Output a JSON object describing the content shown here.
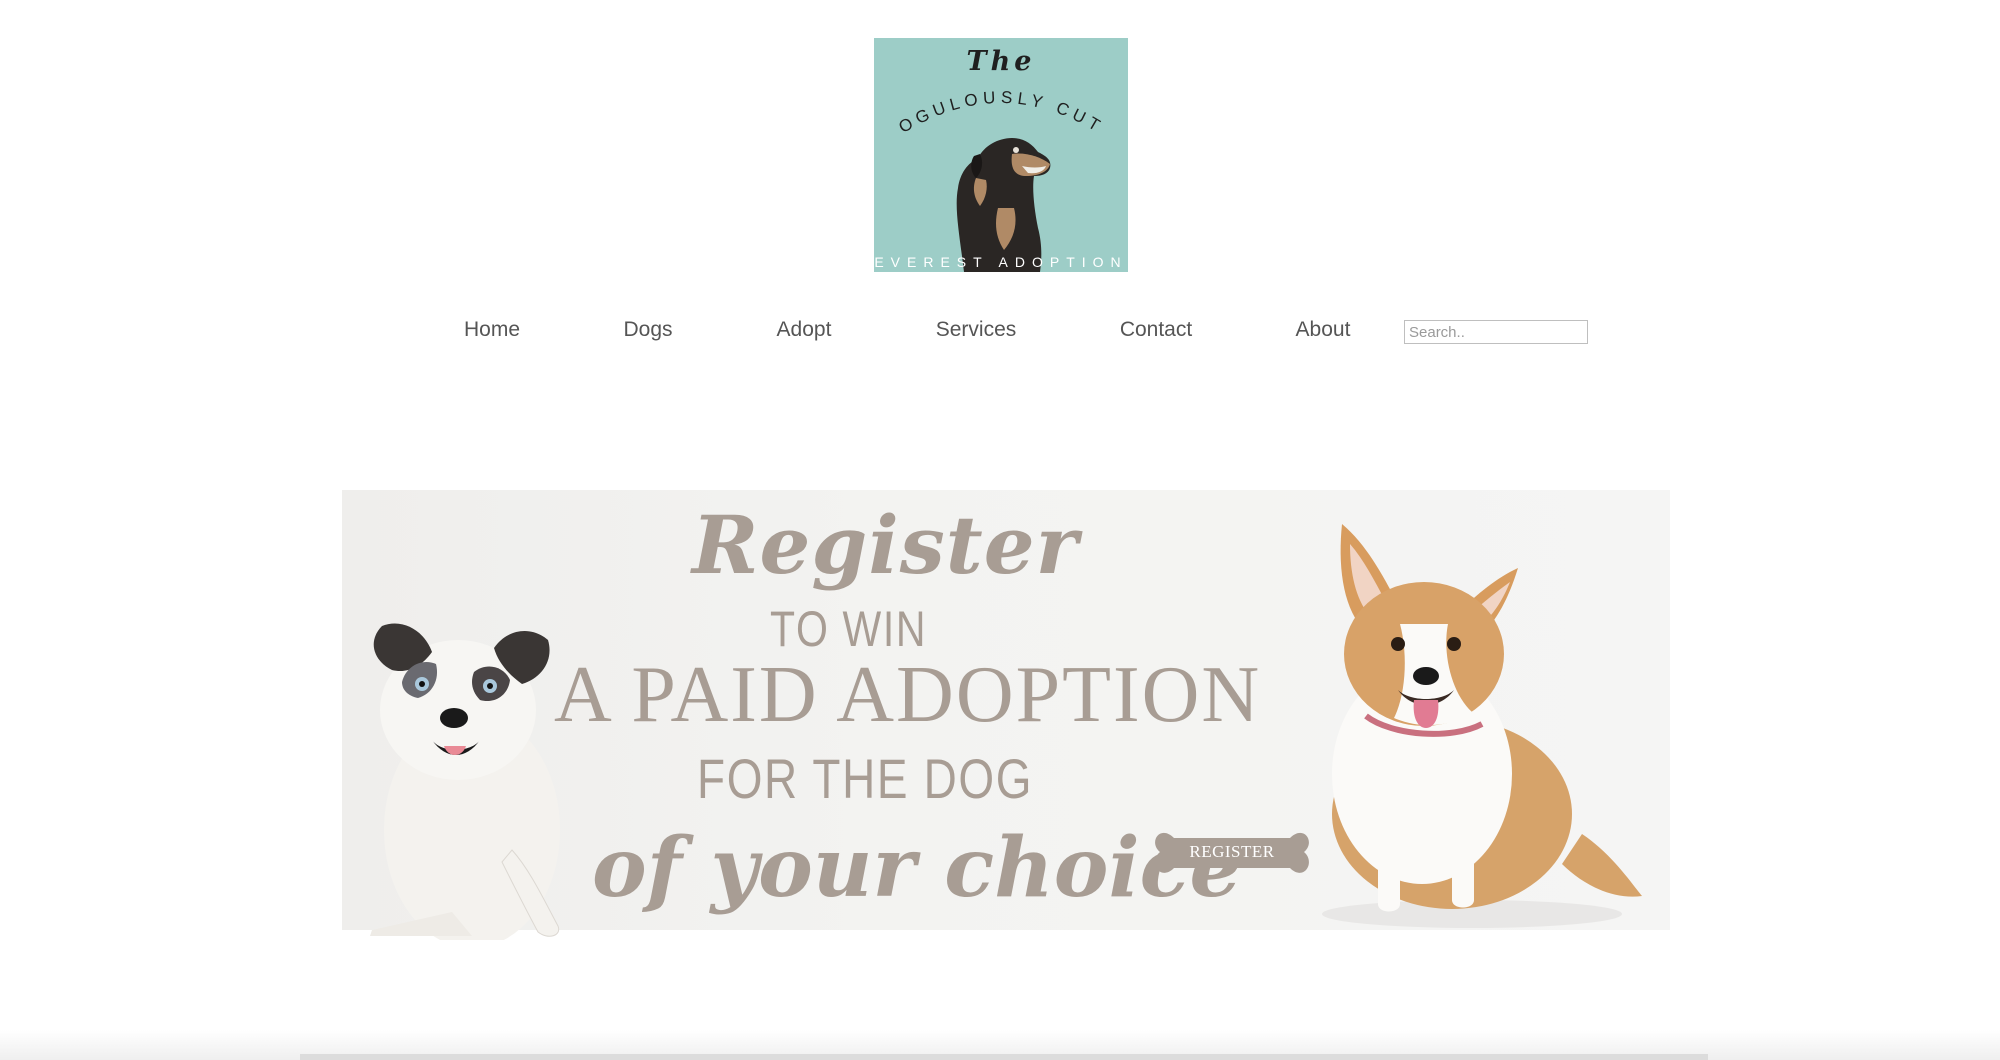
{
  "logo": {
    "top_text": "The",
    "arc_text": "DOGULOUSLY CUTE",
    "bottom_text": "EVEREST ADOPTION",
    "bg_color": "#9dcdc7"
  },
  "nav": {
    "items": [
      {
        "label": "Home"
      },
      {
        "label": "Dogs"
      },
      {
        "label": "Adopt"
      },
      {
        "label": "Services"
      },
      {
        "label": "Contact"
      },
      {
        "label": "About"
      }
    ],
    "search_placeholder": "Search.."
  },
  "banner": {
    "line1": "Register",
    "line2": "TO WIN",
    "line3": "A PAID ADOPTION",
    "line4": "FOR THE DOG",
    "line5": "of your choice",
    "button_label": "REGISTER",
    "text_color": "#a89d94"
  }
}
